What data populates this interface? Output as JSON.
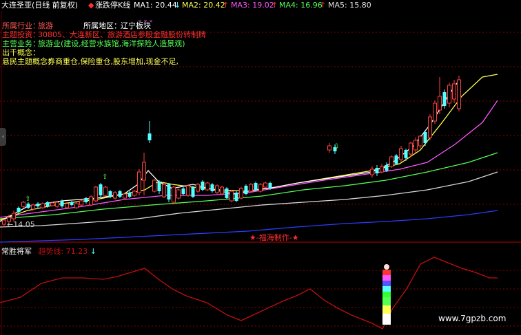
{
  "header": {
    "stock_title": "大连圣亚(日线 前复权)",
    "indicator_name": "涨跌停K线",
    "ma1_label": "MA1: 20.44",
    "ma2_label": "MA2: 20.42",
    "ma3_label": "MA3: 19.02",
    "ma4_label": "MA4: 16.96",
    "ma5_label": "MA5: 15.80",
    "arrow_down": "↓",
    "arrow_up": "↑",
    "diamond": "◆"
  },
  "info": {
    "industry_label": "所属行业：",
    "industry_value": "旅游",
    "region_label": "所属地区：",
    "region_value": "辽宁板块",
    "theme_label": "主题投资：",
    "theme_value": "30805、大连新区、旅游酒店参股金融股份转制牌",
    "business_label": "主营业务：",
    "business_value": "旅游业(建设,经营水族馆,海洋探险人造景观)",
    "quit_label": "出千概念：",
    "hot_label": "悬民主题概念：",
    "hot_value": "券商重仓,保险重仓,股东增加,现金不足,"
  },
  "chart": {
    "low_price_label": "14.05",
    "watermark": "★-福海制作-★",
    "site": "www.7gpzb.com"
  },
  "sub": {
    "title": "常胜将军",
    "trend_label": "趋势线: 71.23",
    "trend_arrow": "↓"
  },
  "colors": {
    "up": "#ff4040",
    "down": "#54ffff",
    "ma1": "#ffffff",
    "ma2": "#ffff55",
    "ma3": "#ff55ff",
    "ma4": "#55ff55",
    "ma5": "#e0e0e0",
    "ma6": "#2b3cff",
    "trend": "#c01010",
    "grid": "#8a0000"
  },
  "chart_data": {
    "type": "candlestick",
    "price_axis_min": 14.05,
    "trend_last": 71.23
  }
}
